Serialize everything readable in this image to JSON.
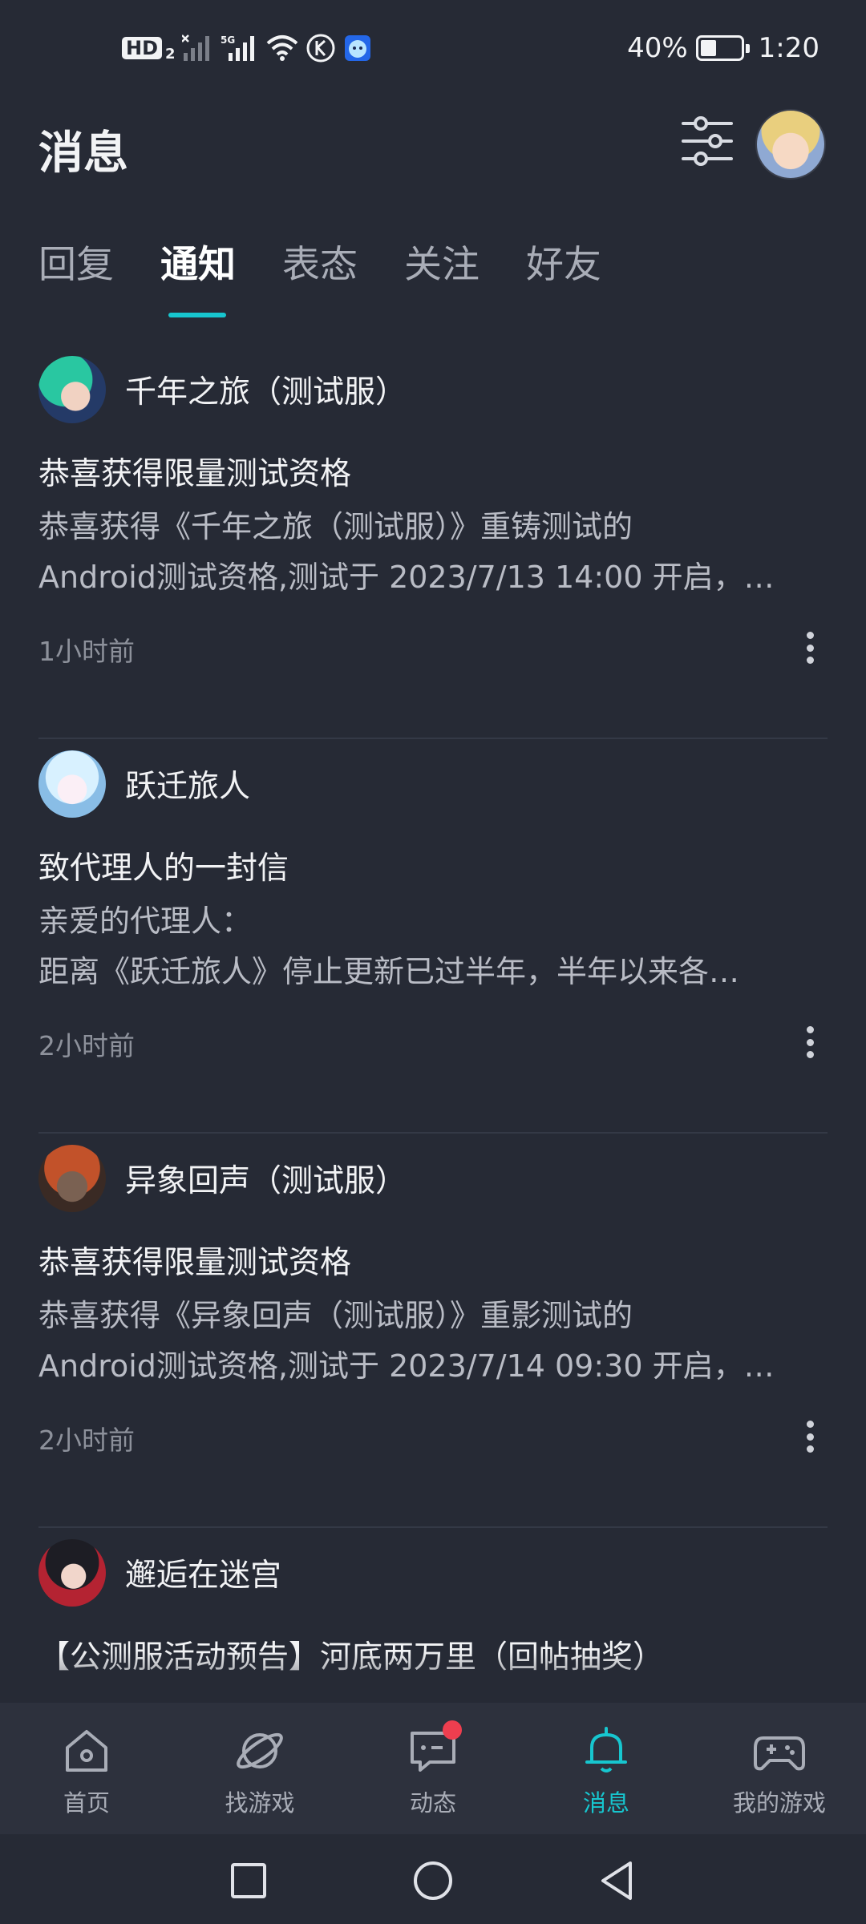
{
  "status_bar": {
    "hd_label": "HD",
    "hd_sub": "2",
    "battery_text": "40%",
    "time": "1:20",
    "battery_level": 0.4
  },
  "header": {
    "title": "消息"
  },
  "tabs": [
    {
      "label": "回复",
      "active": false
    },
    {
      "label": "通知",
      "active": true
    },
    {
      "label": "表态",
      "active": false
    },
    {
      "label": "关注",
      "active": false
    },
    {
      "label": "好友",
      "active": false
    }
  ],
  "notifications": [
    {
      "source": "千年之旅（测试服）",
      "title": "恭喜获得限量测试资格",
      "body_lines": [
        "恭喜获得《千年之旅（测试服）》重铸测试的",
        "Android测试资格,测试于 2023/7/13 14:00 开启，…"
      ],
      "time": "1小时前"
    },
    {
      "source": "跃迁旅人",
      "title": "致代理人的一封信",
      "body_lines": [
        "亲爱的代理人：",
        "距离《跃迁旅人》停止更新已过半年，半年以来各…"
      ],
      "time": "2小时前"
    },
    {
      "source": "异象回声（测试服）",
      "title": "恭喜获得限量测试资格",
      "body_lines": [
        "恭喜获得《异象回声（测试服）》重影测试的",
        "Android测试资格,测试于 2023/7/14 09:30 开启，…"
      ],
      "time": "2小时前"
    },
    {
      "source": "邂逅在迷宫",
      "title": "【公测服活动预告】河底两万里（回帖抽奖）",
      "body_lines": [],
      "time": ""
    }
  ],
  "bottom_nav": [
    {
      "label": "首页",
      "icon": "home-icon"
    },
    {
      "label": "找游戏",
      "icon": "planet-icon"
    },
    {
      "label": "动态",
      "icon": "chat-icon",
      "badge": true
    },
    {
      "label": "消息",
      "icon": "bell-icon",
      "active": true
    },
    {
      "label": "我的游戏",
      "icon": "gamepad-icon"
    }
  ],
  "colors": {
    "background": "#262a35",
    "accent": "#17c6cf",
    "badge": "#ee3e4f",
    "nav_bg": "#2d313d"
  }
}
